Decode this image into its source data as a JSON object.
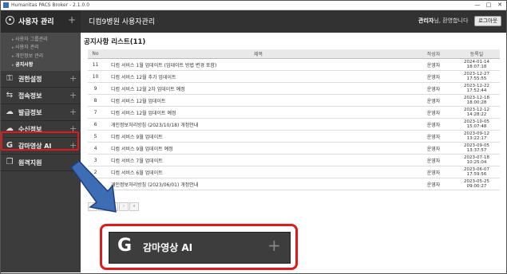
{
  "app": {
    "window_title": "Humanitas PACS Broker - 2.1.0.0",
    "min": "—",
    "max": "□",
    "close": "✕"
  },
  "header": {
    "section_title": "사용자 관리",
    "page_heading": "디컴9병원 사용자관리",
    "user_name": "관리자",
    "user_suffix": "님, 환영합니다",
    "logout_label": "로그아웃",
    "plus": "+"
  },
  "sidebar": {
    "sub_items": [
      {
        "label": "사용자 그룹관리"
      },
      {
        "label": "사용자 관리"
      },
      {
        "label": "개인정보 관리"
      },
      {
        "label": "공지사항"
      }
    ],
    "menus": [
      {
        "icon": "⚿",
        "label": "권한설정",
        "plus": "+"
      },
      {
        "icon": "⇆",
        "label": "접속정보",
        "plus": "+"
      },
      {
        "icon": "☁",
        "label": "발급정보",
        "plus": "+"
      },
      {
        "icon": "☁",
        "label": "수신정보",
        "plus": "+"
      },
      {
        "icon": "G",
        "label": "감마영상 AI",
        "plus": "+"
      },
      {
        "icon": "❐",
        "label": "원격지원",
        "plus": ""
      }
    ]
  },
  "main": {
    "list_title": "공지사항 리스트(11)",
    "columns": [
      "No",
      "제목",
      "작성자",
      "등록일"
    ],
    "rows": [
      {
        "no": "11",
        "title": "디컴 서비스 1월 업데이트 (업데이트 방법 변경 포함)",
        "author": "운영자",
        "date": "2024-01-14",
        "time": "18:07:18"
      },
      {
        "no": "10",
        "title": "디컴 서비스 12월 추가 업데이트",
        "author": "운영자",
        "date": "2023-12-27",
        "time": "17:55:55"
      },
      {
        "no": "9",
        "title": "디컴 서비스 12월 2차 업데이트 예정",
        "author": "운영자",
        "date": "2023-12-22",
        "time": "17:52:44"
      },
      {
        "no": "8",
        "title": "디컴 서비스 12월 업데이트",
        "author": "운영자",
        "date": "2023-12-18",
        "time": "18:00:28"
      },
      {
        "no": "7",
        "title": "디컴 서비스 12월 업데이트 예정",
        "author": "운영자",
        "date": "2023-12-12",
        "time": "14:28:22"
      },
      {
        "no": "6",
        "title": "개인정보처리방침 (2023/10/18) 개정안내",
        "author": "운영자",
        "date": "2023-10-05",
        "time": "15:07:48"
      },
      {
        "no": "5",
        "title": "디컴 서비스 9월 업데이트",
        "author": "운영자",
        "date": "2023-09-12",
        "time": "13:22:17"
      },
      {
        "no": "4",
        "title": "디컴 서비스 9월 업데이트 예정",
        "author": "운영자",
        "date": "2023-09-05",
        "time": "13:37:57"
      },
      {
        "no": "3",
        "title": "디컴 서비스 7월 업데이트",
        "author": "운영자",
        "date": "2023-07-18",
        "time": "10:25:04"
      },
      {
        "no": "2",
        "title": "디컴 서비스 6월 업데이트",
        "author": "운영자",
        "date": "2023-06-07",
        "time": "17:59:56"
      },
      {
        "no": "1",
        "title": "개인정보처리방침 (2023/06/01) 개정안내",
        "author": "운영자",
        "date": "2023-05-25",
        "time": "09:00:27"
      }
    ],
    "pager": [
      "«",
      "‹",
      "1",
      "›",
      "»"
    ]
  },
  "callout": {
    "icon": "G",
    "label": "감마영상 AI",
    "plus": "+",
    "colors": {
      "highlight": "#e0191a",
      "arrow": "#3d6db5"
    }
  }
}
